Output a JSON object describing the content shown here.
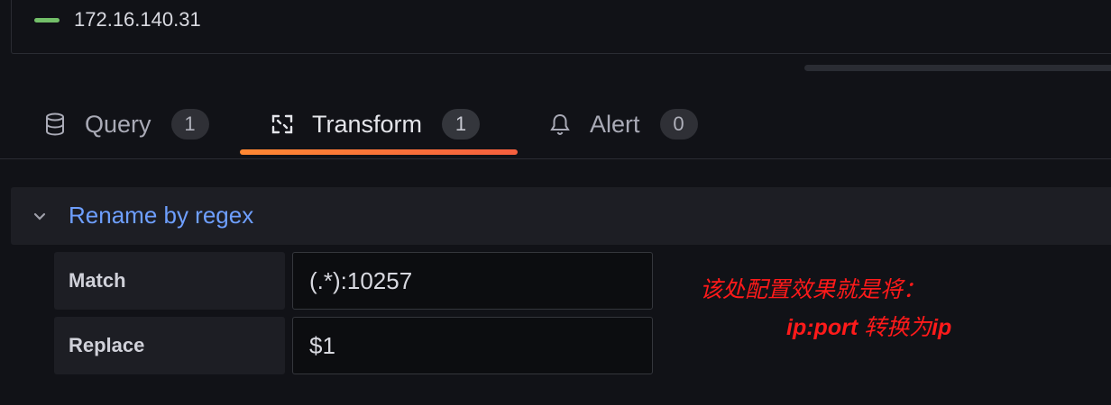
{
  "legend": {
    "label": "172.16.140.31",
    "color": "#73bf69"
  },
  "tabs": [
    {
      "icon": "database-icon",
      "label": "Query",
      "count": "1"
    },
    {
      "icon": "transform-icon",
      "label": "Transform",
      "count": "1"
    },
    {
      "icon": "bell-icon",
      "label": "Alert",
      "count": "0"
    }
  ],
  "active_tab": "Transform",
  "accent_color": "#ff8833",
  "transformation": {
    "title": "Rename by regex",
    "match_label": "Match",
    "match_value": "(.*):10257",
    "replace_label": "Replace",
    "replace_value": "$1"
  },
  "annotation": {
    "line1": "该处配置效果就是将：",
    "line2_a": "ip:port",
    "line2_b": " 转换为",
    "line2_c": "ip",
    "color": "#ff1a1a"
  }
}
